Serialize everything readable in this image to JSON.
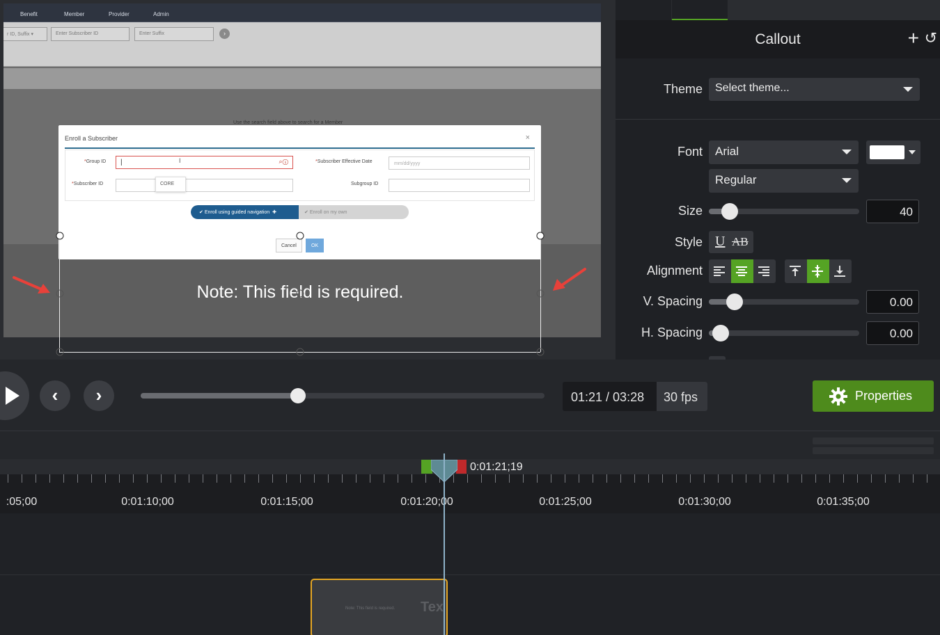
{
  "preview": {
    "nav": [
      "Benefit",
      "Member",
      "Provider",
      "Admin"
    ],
    "search": {
      "id_suffix_select": "r ID, Suffix",
      "subscriber_placeholder": "Enter Subscriber ID",
      "suffix_placeholder": "Enter Suffix"
    },
    "search_hint": "Use the search field above to search for a Member",
    "modal": {
      "title": "Enroll a Subscriber",
      "close": "×",
      "group_id_label": "Group ID",
      "effective_date_label": "Subscriber Effective Date",
      "effective_date_placeholder": "mm/dd/yyyy",
      "subscriber_id_label": "Subscriber ID",
      "subgroup_id_label": "Subgroup ID",
      "suggestion": "CORE",
      "toggle_on": "Enroll using guided navigation",
      "toggle_off": "Enroll on my own",
      "cancel": "Cancel",
      "ok": "OK"
    },
    "callout_text": "Note: This field is required."
  },
  "panel": {
    "title": "Callout",
    "add_icon": "+",
    "reset_icon": "↺",
    "theme_label": "Theme",
    "theme_value": "Select theme...",
    "font_label": "Font",
    "font_value": "Arial",
    "font_weight": "Regular",
    "font_color": "#ffffff",
    "size_label": "Size",
    "size_value": "40",
    "size_level": 0.14,
    "style_label": "Style",
    "alignment_label": "Alignment",
    "v_spacing_label": "V. Spacing",
    "v_spacing_value": "0.00",
    "v_spacing_level": 0.17,
    "h_spacing_label": "H. Spacing",
    "h_spacing_value": "0.00",
    "h_spacing_level": 0.08
  },
  "transport": {
    "time": "01:21 / 03:28",
    "fps": "30 fps",
    "properties": "Properties",
    "progress": 0.39
  },
  "timeline": {
    "playhead_time": "0:01:21;19",
    "ticks": [
      ":05;00",
      "0:01:10;00",
      "0:01:15;00",
      "0:01:20;00",
      "0:01:25;00",
      "0:01:30;00",
      "0:01:35;00"
    ],
    "clip_label": "Tex"
  },
  "colors": {
    "accent_green": "#55a324",
    "properties_button": "#4e8b1c",
    "clip_border": "#e5a623",
    "callout_arrow": "#e8413a"
  }
}
